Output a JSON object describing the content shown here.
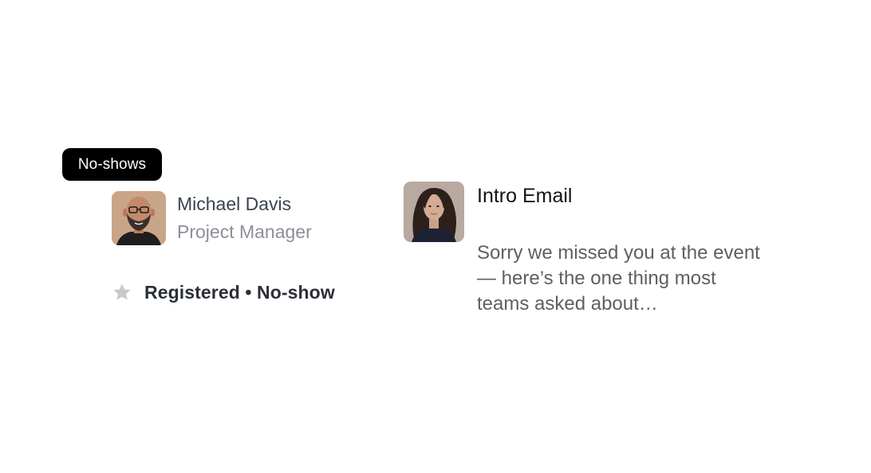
{
  "badge": {
    "label": "No-shows"
  },
  "contact": {
    "name": "Michael Davis",
    "role": "Project Manager",
    "status": "Registered • No-show",
    "status_icon": "star-icon"
  },
  "email": {
    "title": "Intro Email",
    "preview": "Sorry we missed you at the event — here’s the one thing most teams asked about…",
    "sender_avatar": "woman-avatar"
  },
  "colors": {
    "badge_bg": "#000000",
    "badge_text": "#ffffff",
    "name": "#3b4354",
    "role": "#8c8f96",
    "status": "#2b2f36",
    "star": "#c8c8cc",
    "email_title": "#141414",
    "email_preview": "#5d5f63"
  }
}
